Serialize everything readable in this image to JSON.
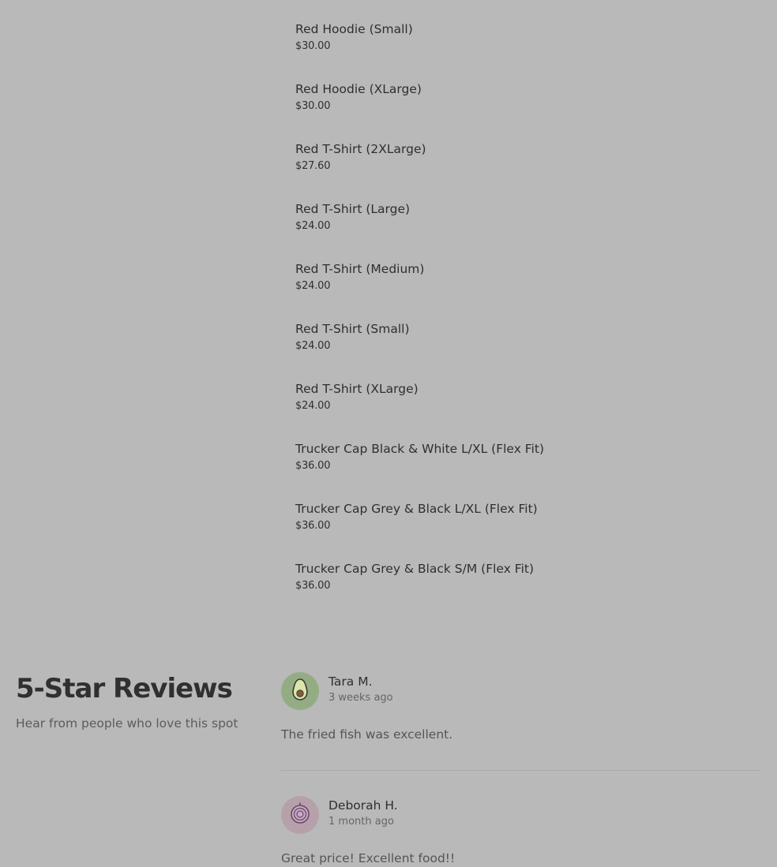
{
  "menu": {
    "items": [
      {
        "name": "Red Hoodie (Small)",
        "price": "$30.00"
      },
      {
        "name": "Red Hoodie (XLarge)",
        "price": "$30.00"
      },
      {
        "name": "Red T-Shirt (2XLarge)",
        "price": "$27.60"
      },
      {
        "name": "Red T-Shirt (Large)",
        "price": "$24.00"
      },
      {
        "name": "Red T-Shirt (Medium)",
        "price": "$24.00"
      },
      {
        "name": "Red T-Shirt (Small)",
        "price": "$24.00"
      },
      {
        "name": "Red T-Shirt (XLarge)",
        "price": "$24.00"
      },
      {
        "name": "Trucker Cap Black & White L/XL (Flex Fit)",
        "price": "$36.00"
      },
      {
        "name": "Trucker Cap Grey & Black L/XL (Flex Fit)",
        "price": "$36.00"
      },
      {
        "name": "Trucker Cap Grey & Black S/M (Flex Fit)",
        "price": "$36.00"
      }
    ]
  },
  "reviews": {
    "title": "5-Star Reviews",
    "subtitle": "Hear from people who love this spot",
    "items": [
      {
        "name": "Tara M.",
        "time": "3 weeks ago",
        "text": "The fried fish was excellent.",
        "avatar_icon": "avocado-icon",
        "avatar_color": "#94ac84"
      },
      {
        "name": "Deborah H.",
        "time": "1 month ago",
        "text": "Great price! Excellent food!!",
        "avatar_icon": "onion-icon",
        "avatar_color": "#b6a1ab"
      }
    ]
  }
}
